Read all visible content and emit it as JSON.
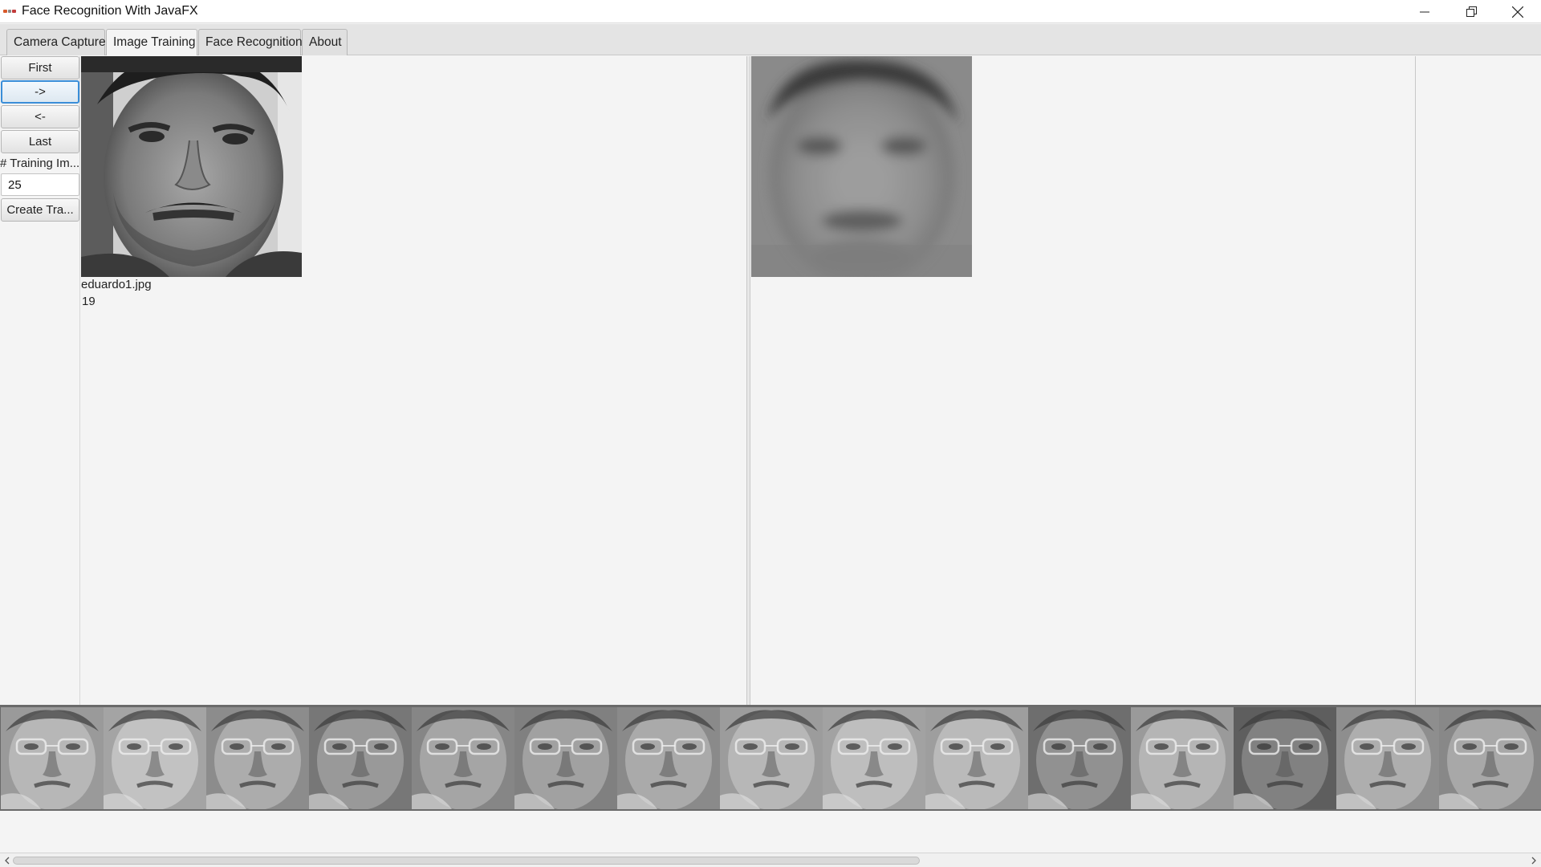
{
  "window": {
    "title": "Face Recognition With JavaFX",
    "controls": [
      "minimize-icon",
      "restore-icon",
      "close-icon"
    ]
  },
  "tabs": [
    {
      "label": "Camera Capture",
      "selected": false
    },
    {
      "label": "Image Training",
      "selected": true
    },
    {
      "label": "Face Recognition",
      "selected": false
    },
    {
      "label": "About",
      "selected": false
    }
  ],
  "controls": {
    "first_label": "First",
    "next_label": "->",
    "prev_label": "<-",
    "last_label": "Last",
    "training_count_label": "# Training Im...",
    "training_count_value": "25",
    "create_label": "Create Tra..."
  },
  "current_image": {
    "filename": "eduardo1.jpg",
    "index": "19"
  },
  "eigen_strip": {
    "thumbnail_count": 15
  },
  "colors": {
    "focus_accent": "#3a8ed8",
    "background": "#f4f4f4"
  }
}
